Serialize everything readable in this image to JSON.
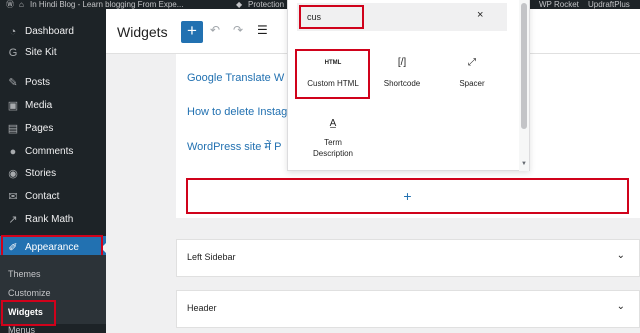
{
  "admin_bar": {
    "site": "In Hindi Blog - Learn blogging From Expe...",
    "protection": "Protection",
    "wp_rocket": "WP Rocket",
    "updraft": "UpdraftPlus"
  },
  "sidebar": {
    "items": [
      {
        "label": "Dashboard",
        "icon": "dashboard-icon"
      },
      {
        "label": "Site Kit",
        "icon": "site-kit-icon"
      },
      {
        "label": "Posts",
        "icon": "pin-icon"
      },
      {
        "label": "Media",
        "icon": "media-icon"
      },
      {
        "label": "Pages",
        "icon": "pages-icon"
      },
      {
        "label": "Comments",
        "icon": "comments-icon"
      },
      {
        "label": "Stories",
        "icon": "stories-icon"
      },
      {
        "label": "Contact",
        "icon": "mail-icon"
      },
      {
        "label": "Rank Math",
        "icon": "chart-icon"
      },
      {
        "label": "Appearance",
        "icon": "brush-icon"
      }
    ],
    "submenu": [
      "Themes",
      "Customize",
      "Widgets",
      "Menus"
    ]
  },
  "header": {
    "title": "Widgets",
    "add_block": "+"
  },
  "content": {
    "links": [
      "Google Translate W",
      "How to delete Instag",
      "WordPress site में P"
    ],
    "append_plus": "+"
  },
  "panels": [
    {
      "title": "Left Sidebar"
    },
    {
      "title": "Header"
    }
  ],
  "inserter": {
    "search_value": "cus",
    "clear": "×",
    "blocks": [
      {
        "icon_text": "HTML",
        "label": "Custom HTML"
      },
      {
        "icon_text": "[/]",
        "label": "Shortcode"
      },
      {
        "icon_text": "⤢",
        "label": "Spacer"
      },
      {
        "icon_text": "A̲",
        "label_line1": "Term",
        "label_line2": "Description"
      }
    ]
  },
  "colors": {
    "accent": "#2271b1",
    "highlight_red": "#d0021b",
    "sidebar_bg": "#1d2327"
  }
}
